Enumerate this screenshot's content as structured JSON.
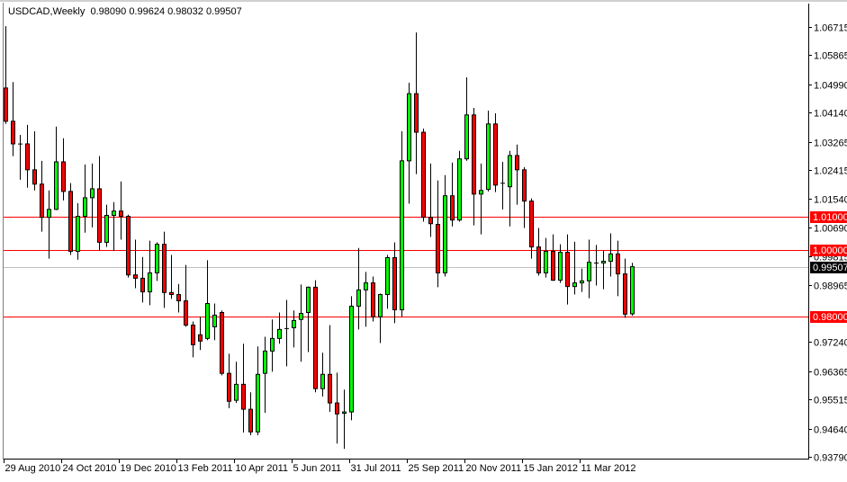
{
  "header": {
    "symbol_timeframe": "USDCAD,Weekly",
    "ohlc_text": "0.98090 0.99624 0.98032 0.99507"
  },
  "colors": {
    "bull": "#00ff00",
    "bear": "#ff0000",
    "outline": "#000000",
    "level_line": "#ff0000",
    "bid_line": "#c0c0c0",
    "bid_label_bg": "#000000",
    "level_label_bg": "#ff0000"
  },
  "chart_data": {
    "type": "candlestick",
    "title": "USDCAD,Weekly",
    "ylim": [
      0.9379,
      1.06715
    ],
    "grid": false,
    "y_ticks": [
      "1.06715",
      "1.05865",
      "1.04990",
      "1.04140",
      "1.03265",
      "1.02415",
      "1.01540",
      "1.00690",
      "0.99815",
      "0.98965",
      "0.97240",
      "0.96365",
      "0.95515",
      "0.94640",
      "0.93790"
    ],
    "x_tick_labels": [
      "29 Aug 2010",
      "24 Oct 2010",
      "19 Dec 2010",
      "13 Feb 2011",
      "10 Apr 2011",
      "5 Jun 2011",
      "31 Jul 2011",
      "25 Sep 2011",
      "20 Nov 2011",
      "15 Jan 2012",
      "11 Mar 2012"
    ],
    "x_tick_every_n_bars": 8,
    "levels": [
      {
        "price": 1.01,
        "label": "1.01000"
      },
      {
        "price": 1.0,
        "label": "1.00000"
      },
      {
        "price": 0.98,
        "label": "0.98000"
      }
    ],
    "bid": {
      "price": 0.99507,
      "label": "0.99507"
    },
    "ohlc": [
      [
        1.0488,
        1.0674,
        1.038,
        1.0388
      ],
      [
        1.0388,
        1.0506,
        1.0283,
        1.032
      ],
      [
        1.032,
        1.0347,
        1.0212,
        1.0321
      ],
      [
        1.032,
        1.0377,
        1.0188,
        1.0242
      ],
      [
        1.0242,
        1.0358,
        1.018,
        1.0199
      ],
      [
        1.0199,
        1.0269,
        1.0056,
        1.0099
      ],
      [
        1.0099,
        1.018,
        0.9975,
        1.0123
      ],
      [
        1.0123,
        1.0372,
        1.0121,
        1.0266
      ],
      [
        1.0266,
        1.0337,
        1.015,
        1.0177
      ],
      [
        1.0177,
        1.0202,
        0.9986,
        0.9997
      ],
      [
        0.9997,
        1.0142,
        0.9972,
        1.0102
      ],
      [
        1.0102,
        1.0258,
        1.0053,
        1.0158
      ],
      [
        1.0158,
        1.0261,
        1.0069,
        1.0185
      ],
      [
        1.0185,
        1.0283,
        0.9999,
        1.0024
      ],
      [
        1.0024,
        1.0137,
        1.001,
        1.0105
      ],
      [
        1.0105,
        1.0145,
        0.9999,
        1.0118
      ],
      [
        1.0118,
        1.0207,
        1.0032,
        1.0102
      ],
      [
        1.0102,
        1.0107,
        0.9918,
        0.9926
      ],
      [
        0.9926,
        1.0032,
        0.9886,
        0.9916
      ],
      [
        0.9916,
        0.998,
        0.9843,
        0.9875
      ],
      [
        0.9875,
        1.0029,
        0.9835,
        0.9932
      ],
      [
        0.9932,
        1.0024,
        0.9908,
        1.0018
      ],
      [
        1.0018,
        1.0056,
        0.9827,
        0.9873
      ],
      [
        0.9873,
        0.9986,
        0.9854,
        0.9867
      ],
      [
        0.9867,
        0.9899,
        0.9813,
        0.9848
      ],
      [
        0.9848,
        0.9956,
        0.977,
        0.9775
      ],
      [
        0.9775,
        0.9786,
        0.9678,
        0.9716
      ],
      [
        0.9746,
        0.98,
        0.97,
        0.9727
      ],
      [
        0.9735,
        0.997,
        0.973,
        0.984
      ],
      [
        0.977,
        0.984,
        0.973,
        0.9805
      ],
      [
        0.9813,
        0.9819,
        0.9624,
        0.963
      ],
      [
        0.963,
        0.9689,
        0.9525,
        0.9546
      ],
      [
        0.9549,
        0.9665,
        0.9541,
        0.9597
      ],
      [
        0.9597,
        0.9719,
        0.9452,
        0.9522
      ],
      [
        0.9522,
        0.9573,
        0.9444,
        0.9454
      ],
      [
        0.9454,
        0.9711,
        0.9444,
        0.9627
      ],
      [
        0.963,
        0.974,
        0.9511,
        0.9697
      ],
      [
        0.9697,
        0.9792,
        0.9635,
        0.9735
      ],
      [
        0.9735,
        0.9813,
        0.9719,
        0.9762
      ],
      [
        0.9765,
        0.9851,
        0.9651,
        0.9766
      ],
      [
        0.9767,
        0.9819,
        0.9708,
        0.9789
      ],
      [
        0.9792,
        0.9897,
        0.9665,
        0.981
      ],
      [
        0.9813,
        0.9891,
        0.9694,
        0.9889
      ],
      [
        0.9889,
        0.991,
        0.9573,
        0.9584
      ],
      [
        0.9584,
        0.9692,
        0.956,
        0.9627
      ],
      [
        0.9627,
        0.9775,
        0.9514,
        0.9541
      ],
      [
        0.9541,
        0.9632,
        0.9419,
        0.9508
      ],
      [
        0.951,
        0.9581,
        0.9403,
        0.9514
      ],
      [
        0.9514,
        0.9862,
        0.9489,
        0.9832
      ],
      [
        0.9832,
        1.0007,
        0.9762,
        0.9881
      ],
      [
        0.9881,
        0.9935,
        0.977,
        0.9902
      ],
      [
        0.9902,
        0.9921,
        0.9786,
        0.98
      ],
      [
        0.98,
        0.987,
        0.9721,
        0.9867
      ],
      [
        0.9867,
        0.9986,
        0.9824,
        0.9978
      ],
      [
        0.9978,
        1.0024,
        0.9781,
        0.9821
      ],
      [
        0.9821,
        1.0358,
        0.98,
        1.0269
      ],
      [
        1.0269,
        1.0504,
        1.014,
        1.0471
      ],
      [
        1.0471,
        1.0655,
        1.0229,
        1.0355
      ],
      [
        1.0355,
        1.0366,
        1.0086,
        1.0099
      ],
      [
        1.0099,
        1.0261,
        1.004,
        1.008
      ],
      [
        1.0078,
        1.021,
        0.9889,
        0.9932
      ],
      [
        0.9932,
        1.0226,
        0.9921,
        1.0164
      ],
      [
        1.0164,
        1.0264,
        1.0072,
        1.0091
      ],
      [
        1.0091,
        1.0299,
        1.0086,
        1.0275
      ],
      [
        1.0275,
        1.052,
        1.0269,
        1.0407
      ],
      [
        1.0407,
        1.0428,
        1.0075,
        1.0169
      ],
      [
        1.0169,
        1.0261,
        1.0048,
        1.018
      ],
      [
        1.0183,
        1.042,
        1.0177,
        1.038
      ],
      [
        1.038,
        1.0412,
        1.0175,
        1.0196
      ],
      [
        1.0202,
        1.0266,
        1.0123,
        1.0203
      ],
      [
        1.0191,
        1.0299,
        1.0072,
        1.0285
      ],
      [
        1.0285,
        1.0318,
        1.0137,
        1.0242
      ],
      [
        1.0242,
        1.025,
        1.0067,
        1.0148
      ],
      [
        1.0148,
        1.0156,
        0.9975,
        1.001
      ],
      [
        1.001,
        1.0067,
        0.9924,
        0.9932
      ],
      [
        0.9932,
        1.0037,
        0.9918,
        0.9997
      ],
      [
        0.9997,
        1.0048,
        0.9908,
        0.991
      ],
      [
        0.991,
        1.0018,
        0.9902,
        0.9994
      ],
      [
        0.9994,
        1.0048,
        0.9837,
        0.9891
      ],
      [
        0.9891,
        1.0026,
        0.9867,
        0.9902
      ],
      [
        0.9902,
        0.9945,
        0.9875,
        0.9908
      ],
      [
        0.9908,
        1.0032,
        0.9856,
        0.9964
      ],
      [
        0.9962,
        1.0016,
        0.9894,
        0.9963
      ],
      [
        0.9962,
        0.9999,
        0.9883,
        0.9967
      ],
      [
        0.9967,
        1.0051,
        0.9921,
        0.9989
      ],
      [
        0.9989,
        1.0029,
        0.9862,
        0.9929
      ],
      [
        0.9929,
        0.9975,
        0.9797,
        0.9808
      ],
      [
        0.9809,
        0.99624,
        0.98032,
        0.99507
      ]
    ]
  }
}
